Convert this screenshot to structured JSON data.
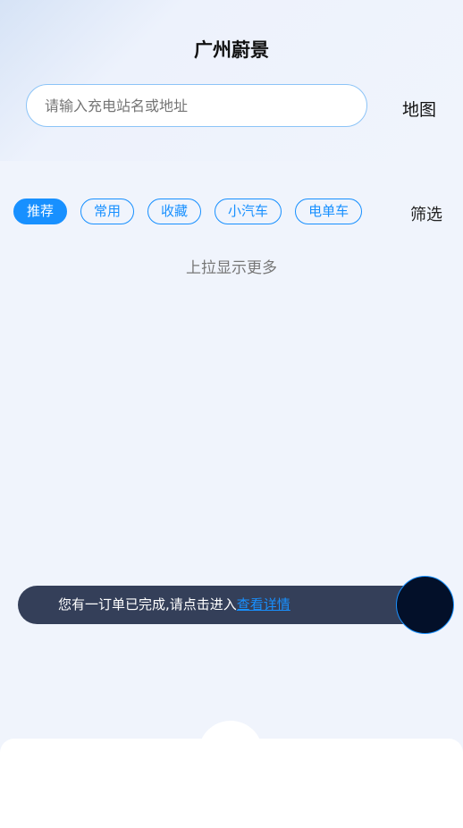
{
  "header": {
    "title": "广州蔚景",
    "map_label": "地图"
  },
  "search": {
    "placeholder": "请输入充电站名或地址",
    "value": ""
  },
  "tabs": [
    {
      "label": "推荐",
      "active": true
    },
    {
      "label": "常用"
    },
    {
      "label": "收藏"
    },
    {
      "label": "小汽车"
    },
    {
      "label": "电单车"
    }
  ],
  "filter_label": "筛选",
  "load_more": "上拉显示更多",
  "notice": {
    "text": "您有一订单已完成,请点击进入",
    "link": "查看详情"
  },
  "colors": {
    "accent": "#1890ff",
    "notice_bg": "#343f59"
  }
}
